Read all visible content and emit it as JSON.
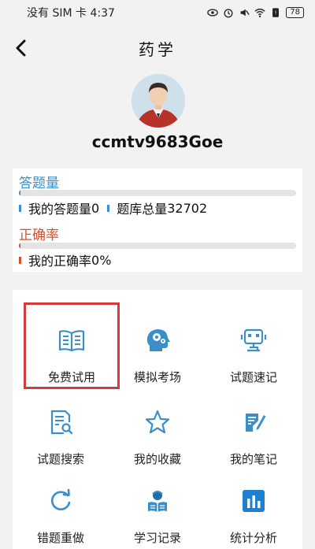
{
  "status_bar": {
    "carrier_time": "没有 SIM 卡 4:37",
    "battery": "78"
  },
  "nav": {
    "title": "药学"
  },
  "profile": {
    "username": "ccmtv9683Goe"
  },
  "stats": {
    "answered_title": "答题量",
    "answered_progress_fraction": 0.0,
    "my_answered_label": "我的答题量",
    "my_answered_value": "0",
    "total_label": "题库总量",
    "total_value": "32702",
    "accuracy_title": "正确率",
    "accuracy_progress_fraction": 0.0,
    "my_accuracy_label": "我的正确率",
    "my_accuracy_value": "0%"
  },
  "menu": {
    "items": [
      {
        "label": "免费试用",
        "icon": "book-icon"
      },
      {
        "label": "模拟考场",
        "icon": "head-gears-icon"
      },
      {
        "label": "试题速记",
        "icon": "robot-icon"
      },
      {
        "label": "试题搜索",
        "icon": "document-search-icon"
      },
      {
        "label": "我的收藏",
        "icon": "star-icon"
      },
      {
        "label": "我的笔记",
        "icon": "note-pen-icon"
      },
      {
        "label": "错题重做",
        "icon": "refresh-icon"
      },
      {
        "label": "学习记录",
        "icon": "reader-icon"
      },
      {
        "label": "统计分析",
        "icon": "bar-chart-icon"
      }
    ],
    "highlighted_index": 0
  },
  "colors": {
    "accent_blue": "#3b8fc9",
    "accent_red": "#d2502f",
    "highlight_border": "#d33a3a"
  }
}
